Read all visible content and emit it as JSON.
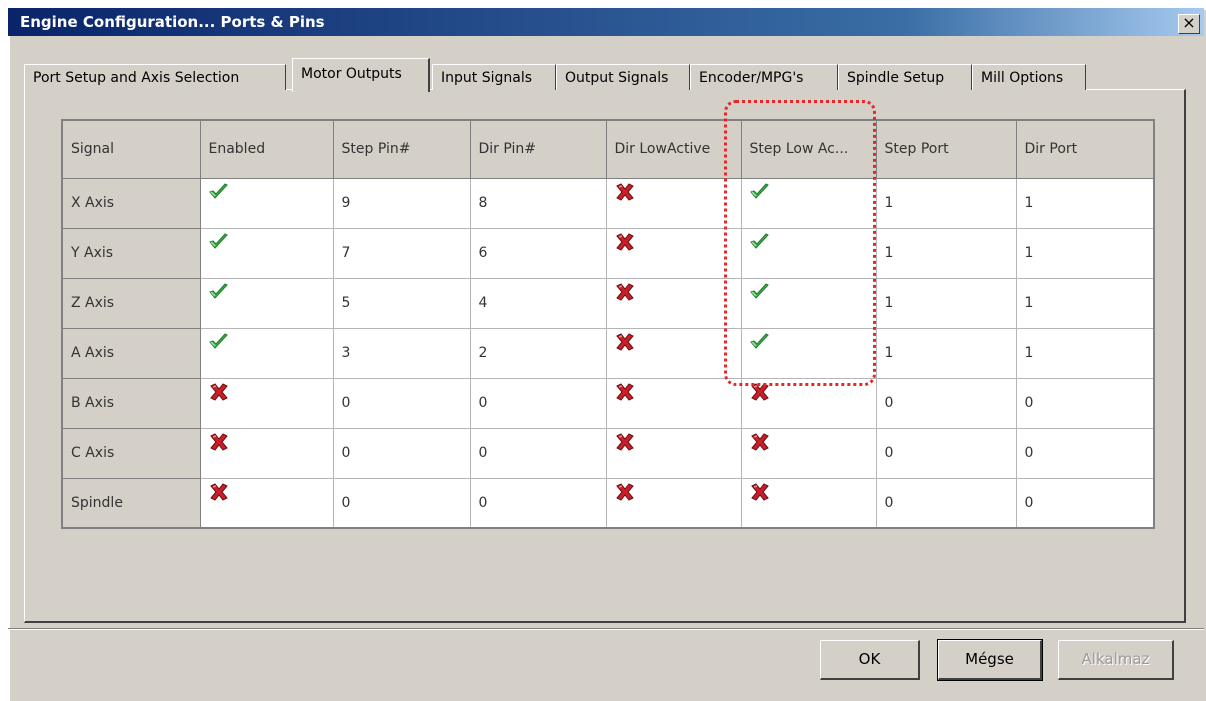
{
  "window": {
    "title": "Engine Configuration... Ports & Pins",
    "close_label": "×"
  },
  "tabs": [
    {
      "label": "Port Setup and Axis Selection",
      "active": false
    },
    {
      "label": "Motor Outputs",
      "active": true
    },
    {
      "label": "Input Signals",
      "active": false
    },
    {
      "label": "Output Signals",
      "active": false
    },
    {
      "label": "Encoder/MPG's",
      "active": false
    },
    {
      "label": "Spindle Setup",
      "active": false
    },
    {
      "label": "Mill Options",
      "active": false
    }
  ],
  "grid": {
    "columns": [
      "Signal",
      "Enabled",
      "Step Pin#",
      "Dir Pin#",
      "Dir LowActive",
      "Step Low Ac...",
      "Step Port",
      "Dir Port"
    ],
    "rows": [
      {
        "signal": "X Axis",
        "enabled": true,
        "step_pin": "9",
        "dir_pin": "8",
        "dir_low_active": false,
        "step_low_active": true,
        "step_port": "1",
        "dir_port": "1"
      },
      {
        "signal": "Y Axis",
        "enabled": true,
        "step_pin": "7",
        "dir_pin": "6",
        "dir_low_active": false,
        "step_low_active": true,
        "step_port": "1",
        "dir_port": "1"
      },
      {
        "signal": "Z Axis",
        "enabled": true,
        "step_pin": "5",
        "dir_pin": "4",
        "dir_low_active": false,
        "step_low_active": true,
        "step_port": "1",
        "dir_port": "1"
      },
      {
        "signal": "A Axis",
        "enabled": true,
        "step_pin": "3",
        "dir_pin": "2",
        "dir_low_active": false,
        "step_low_active": true,
        "step_port": "1",
        "dir_port": "1"
      },
      {
        "signal": "B Axis",
        "enabled": false,
        "step_pin": "0",
        "dir_pin": "0",
        "dir_low_active": false,
        "step_low_active": false,
        "step_port": "0",
        "dir_port": "0"
      },
      {
        "signal": "C Axis",
        "enabled": false,
        "step_pin": "0",
        "dir_pin": "0",
        "dir_low_active": false,
        "step_low_active": false,
        "step_port": "0",
        "dir_port": "0"
      },
      {
        "signal": "Spindle",
        "enabled": false,
        "step_pin": "0",
        "dir_pin": "0",
        "dir_low_active": false,
        "step_low_active": false,
        "step_port": "0",
        "dir_port": "0"
      }
    ]
  },
  "icons": {
    "true": "green-check-icon",
    "false": "red-x-icon"
  },
  "colors": {
    "check": "#3cb44a",
    "cross": "#c8202a",
    "highlight": "#e8262a",
    "title_bar": "#0a246a"
  },
  "buttons": {
    "ok": "OK",
    "cancel": "Mégse",
    "apply": "Alkalmaz"
  }
}
